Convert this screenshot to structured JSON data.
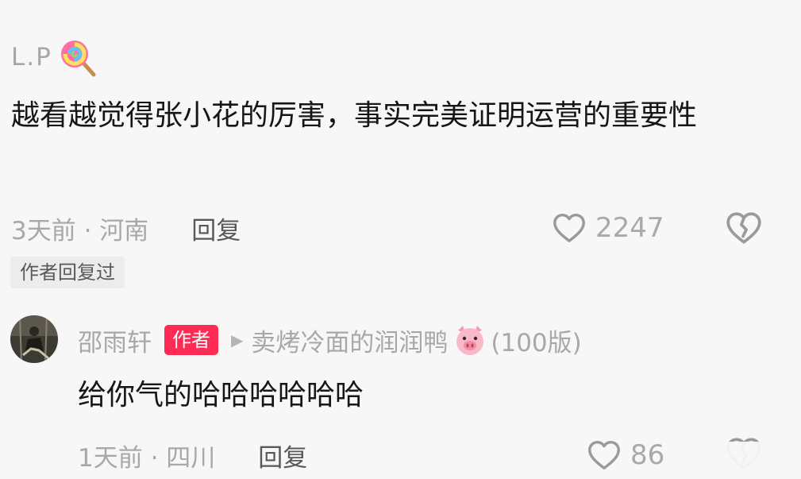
{
  "comment": {
    "username": "L.P",
    "username_emoji": "lollipop-icon",
    "text": "越看越觉得张小花的厉害，事实完美证明运营的重要性",
    "time_location": "3天前 · 河南",
    "reply_label": "回复",
    "like_count": "2247",
    "author_replied_badge": "作者回复过"
  },
  "reply": {
    "username": "邵雨轩",
    "author_badge": "作者",
    "reply_to": "卖烤冷面的润润鸭",
    "reply_to_emoji": "pig-face-icon",
    "version": "(100版)",
    "text": "给你气的哈哈哈哈哈哈",
    "time_location": "1天前 · 四川",
    "reply_label": "回复",
    "like_count": "86"
  },
  "colors": {
    "author_badge_bg": "#fe2c55",
    "muted_text": "#a8a8a8",
    "main_text": "#161616"
  }
}
